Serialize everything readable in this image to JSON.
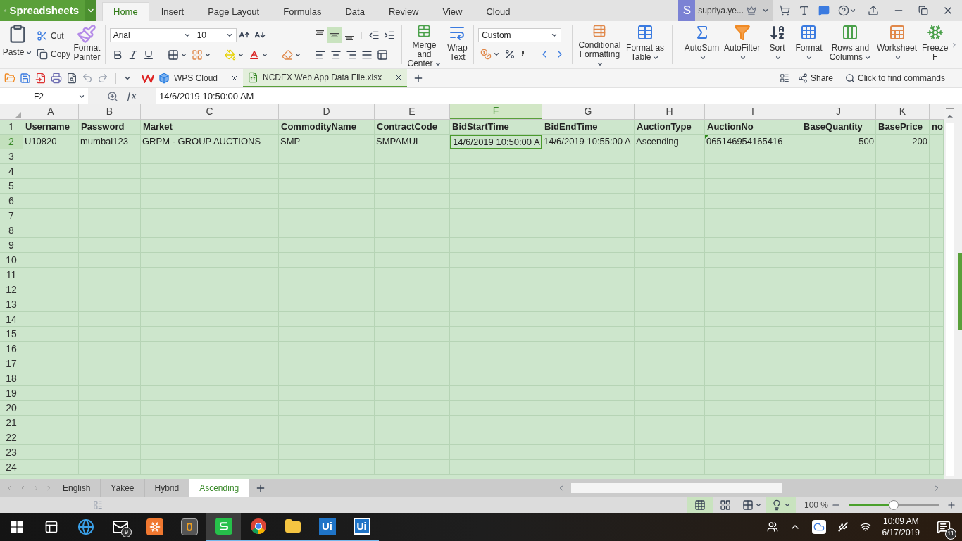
{
  "title_bar": {
    "app_button": "Spreadsheets",
    "tabs": [
      {
        "label": "Home",
        "selected": true
      },
      {
        "label": "Insert",
        "selected": false
      },
      {
        "label": "Page Layout",
        "selected": false
      },
      {
        "label": "Formulas",
        "selected": false
      },
      {
        "label": "Data",
        "selected": false
      },
      {
        "label": "Review",
        "selected": false
      },
      {
        "label": "View",
        "selected": false
      },
      {
        "label": "Cloud",
        "selected": false
      }
    ],
    "account": {
      "initial": "S",
      "name": "supriya.ye..."
    }
  },
  "ribbon": {
    "paste": "Paste",
    "cut": "Cut",
    "copy": "Copy",
    "format_painter": "Format Painter",
    "font_name": "Arial",
    "font_size": "10",
    "vertical_align": [
      {
        "selected": false
      },
      {
        "selected": true
      },
      {
        "selected": false
      }
    ],
    "merge": "Merge and Center",
    "wrap": "Wrap Text",
    "number_format": "Custom",
    "style_buttons": [
      {
        "kind": "conditional",
        "label": "Conditional Formatting"
      },
      {
        "kind": "table",
        "label": "Format as Table"
      }
    ],
    "tool_buttons": [
      {
        "kind": "autosum",
        "label": "AutoSum",
        "dropdown": true
      },
      {
        "kind": "autofilter",
        "label": "AutoFilter",
        "dropdown": true
      },
      {
        "kind": "sort",
        "label": "Sort",
        "dropdown": true
      },
      {
        "kind": "format",
        "label": "Format",
        "dropdown": true
      },
      {
        "kind": "rows_columns",
        "label": "Rows and Columns",
        "dropdown": true
      },
      {
        "kind": "worksheet",
        "label": "Worksheet",
        "dropdown": true
      },
      {
        "kind": "freeze",
        "label": "Freeze F",
        "dropdown": false
      }
    ]
  },
  "doc_bar": {
    "tabs": [
      {
        "kind": "cloud",
        "label": "WPS Cloud",
        "selected": false
      },
      {
        "kind": "file",
        "label": "NCDEX Web App Data File.xlsx",
        "selected": true
      }
    ],
    "share": "Share",
    "command_search": {
      "placeholder": "Click to find commands"
    }
  },
  "formula_bar": {
    "cell_ref": "F2",
    "function_label": "fx",
    "value": "14/6/2019 10:50:00 AM"
  },
  "sheet": {
    "columns": [
      {
        "letter": "A",
        "selected": false
      },
      {
        "letter": "B",
        "selected": false
      },
      {
        "letter": "C",
        "selected": false
      },
      {
        "letter": "D",
        "selected": false
      },
      {
        "letter": "E",
        "selected": false
      },
      {
        "letter": "F",
        "selected": true
      },
      {
        "letter": "G",
        "selected": false
      },
      {
        "letter": "H",
        "selected": false
      },
      {
        "letter": "I",
        "selected": false
      },
      {
        "letter": "J",
        "selected": false
      },
      {
        "letter": "K",
        "selected": false
      }
    ],
    "rows": [
      {
        "number": "1",
        "selected": false,
        "kind": "header",
        "cells": [
          "Username",
          "Password",
          "Market",
          "CommodityName",
          "ContractCode",
          "BidStartTime",
          "BidEndTime",
          "AuctionType",
          "AuctionNo",
          "BaseQuantity",
          "BasePrice",
          "no"
        ]
      },
      {
        "number": "2",
        "selected": true,
        "kind": "data",
        "cells": [
          {
            "text": "U10820",
            "kind": "text",
            "selected": false,
            "flag": false
          },
          {
            "text": "mumbai123",
            "kind": "text",
            "selected": false,
            "flag": false
          },
          {
            "text": "GRPM - GROUP AUCTIONS",
            "kind": "text",
            "selected": false,
            "flag": false
          },
          {
            "text": "SMP",
            "kind": "text",
            "selected": false,
            "flag": false
          },
          {
            "text": "SMPAMUL",
            "kind": "text",
            "selected": false,
            "flag": false
          },
          {
            "text": "14/6/2019 10:50:00 A",
            "kind": "text",
            "selected": true,
            "flag": false
          },
          {
            "text": "14/6/2019 10:55:00 A",
            "kind": "text",
            "selected": false,
            "flag": false
          },
          {
            "text": "Ascending",
            "kind": "text",
            "selected": false,
            "flag": false
          },
          {
            "text": "065146954165416",
            "kind": "text",
            "selected": false,
            "flag": true
          },
          {
            "text": "500",
            "kind": "number",
            "selected": false,
            "flag": false
          },
          {
            "text": "200",
            "kind": "number",
            "selected": false,
            "flag": false
          }
        ]
      },
      {
        "number": "3",
        "selected": false,
        "kind": "empty"
      },
      {
        "number": "4",
        "selected": false,
        "kind": "empty"
      },
      {
        "number": "5",
        "selected": false,
        "kind": "empty"
      },
      {
        "number": "6",
        "selected": false,
        "kind": "empty"
      },
      {
        "number": "7",
        "selected": false,
        "kind": "empty"
      },
      {
        "number": "8",
        "selected": false,
        "kind": "empty"
      },
      {
        "number": "9",
        "selected": false,
        "kind": "empty"
      },
      {
        "number": "10",
        "selected": false,
        "kind": "empty"
      },
      {
        "number": "11",
        "selected": false,
        "kind": "empty"
      },
      {
        "number": "12",
        "selected": false,
        "kind": "empty"
      },
      {
        "number": "13",
        "selected": false,
        "kind": "empty"
      },
      {
        "number": "14",
        "selected": false,
        "kind": "empty"
      },
      {
        "number": "15",
        "selected": false,
        "kind": "empty"
      },
      {
        "number": "16",
        "selected": false,
        "kind": "empty"
      },
      {
        "number": "17",
        "selected": false,
        "kind": "empty"
      },
      {
        "number": "18",
        "selected": false,
        "kind": "empty"
      },
      {
        "number": "19",
        "selected": false,
        "kind": "empty"
      },
      {
        "number": "20",
        "selected": false,
        "kind": "empty"
      },
      {
        "number": "21",
        "selected": false,
        "kind": "empty"
      },
      {
        "number": "22",
        "selected": false,
        "kind": "empty"
      },
      {
        "number": "23",
        "selected": false,
        "kind": "empty"
      },
      {
        "number": "24",
        "selected": false,
        "kind": "empty"
      }
    ]
  },
  "sheet_tabs": [
    {
      "label": "English",
      "selected": false
    },
    {
      "label": "Yakee",
      "selected": false
    },
    {
      "label": "Hybrid",
      "selected": false
    },
    {
      "label": "Ascending",
      "selected": true
    }
  ],
  "status_bar": {
    "view_modes": [
      {
        "selected": true
      },
      {
        "selected": false
      }
    ],
    "reading_mode": {
      "on": true
    },
    "zoom_label": "100 %",
    "zoom": {
      "level": 0.5
    }
  },
  "taskbar": {
    "apps": [
      {
        "kind": "task_view",
        "running": false,
        "selected": false
      },
      {
        "kind": "browser",
        "running": false,
        "selected": false
      },
      {
        "kind": "mail",
        "running": false,
        "selected": false,
        "badge": "9"
      },
      {
        "kind": "server",
        "running": false,
        "selected": false
      },
      {
        "kind": "editor",
        "running": false,
        "selected": false
      },
      {
        "kind": "spreadsheets",
        "running": true,
        "selected": true
      },
      {
        "kind": "chrome",
        "running": true,
        "selected": false
      },
      {
        "kind": "folder",
        "running": true,
        "selected": false
      },
      {
        "kind": "ui",
        "running": true,
        "selected": false,
        "label": "Ui"
      },
      {
        "kind": "ui_outline",
        "running": true,
        "selected": false,
        "label": "Ui"
      }
    ],
    "time": "10:09 AM",
    "date": "6/17/2019",
    "notifications": "11"
  }
}
